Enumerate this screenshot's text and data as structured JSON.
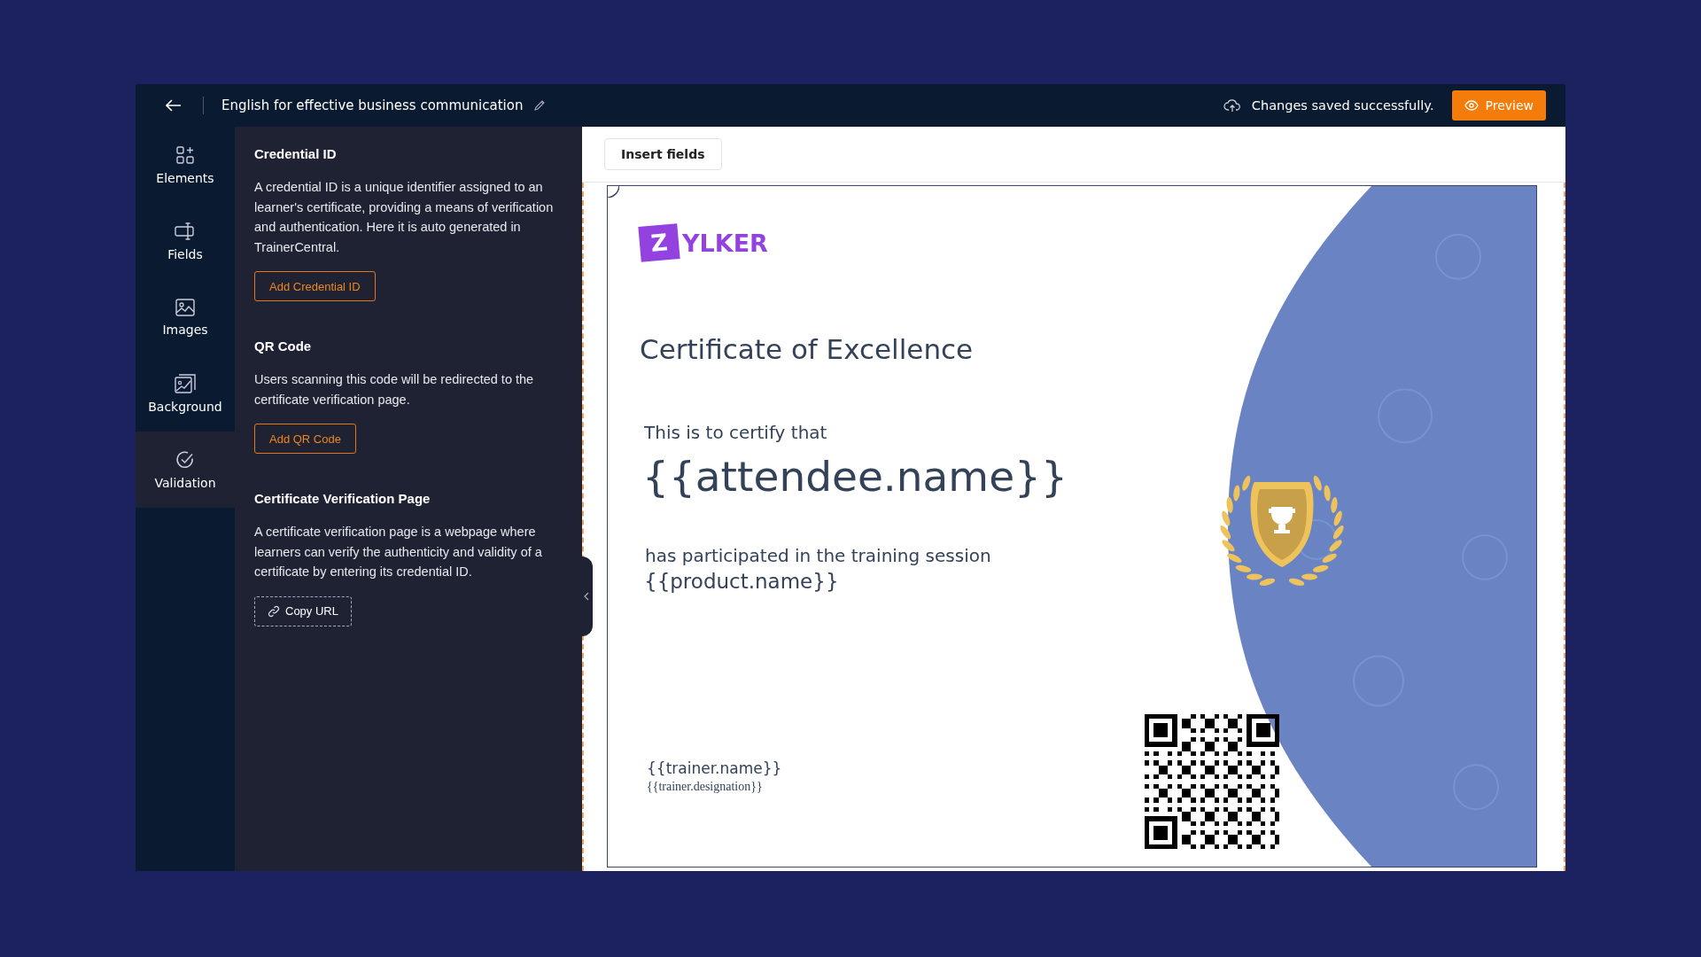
{
  "top_bar": {
    "title": "English for effective business communication",
    "status": "Changes saved successfully.",
    "preview_button": "Preview"
  },
  "sidebar": {
    "items": [
      {
        "label": "Elements",
        "selected": false
      },
      {
        "label": "Fields",
        "selected": false
      },
      {
        "label": "Images",
        "selected": false
      },
      {
        "label": "Background",
        "selected": false
      },
      {
        "label": "Validation",
        "selected": true
      }
    ]
  },
  "panel": {
    "sections": [
      {
        "heading": "Credential ID",
        "text": "A credential ID is a unique identifier assigned to an learner's certificate, providing a means of verification and authentication. Here it is auto generated in TrainerCentral.",
        "button": "Add Credential ID",
        "kind": "primary"
      },
      {
        "heading": "QR Code",
        "text": "Users scanning this code will be redirected to the certificate verification page.",
        "button": "Add QR Code",
        "kind": "primary"
      },
      {
        "heading": "Certificate Verification Page",
        "text": "A certificate verification page is a webpage where learners can verify the authenticity and validity of a certificate by entering its credential ID.",
        "button": "Copy URL",
        "kind": "link"
      }
    ]
  },
  "canvas": {
    "insert_fields_button": "Insert fields"
  },
  "certificate": {
    "logo_mark": "Z",
    "logo_text": "YLKER",
    "title": "Certificate of Excellence",
    "intro": "This is to certify that",
    "attendee": "{{attendee.name}}",
    "participation": "has participated in the training session",
    "product": "{{product.name}}",
    "trainer_name": "{{trainer.name}}",
    "trainer_designation": "{{trainer.designation}}"
  }
}
